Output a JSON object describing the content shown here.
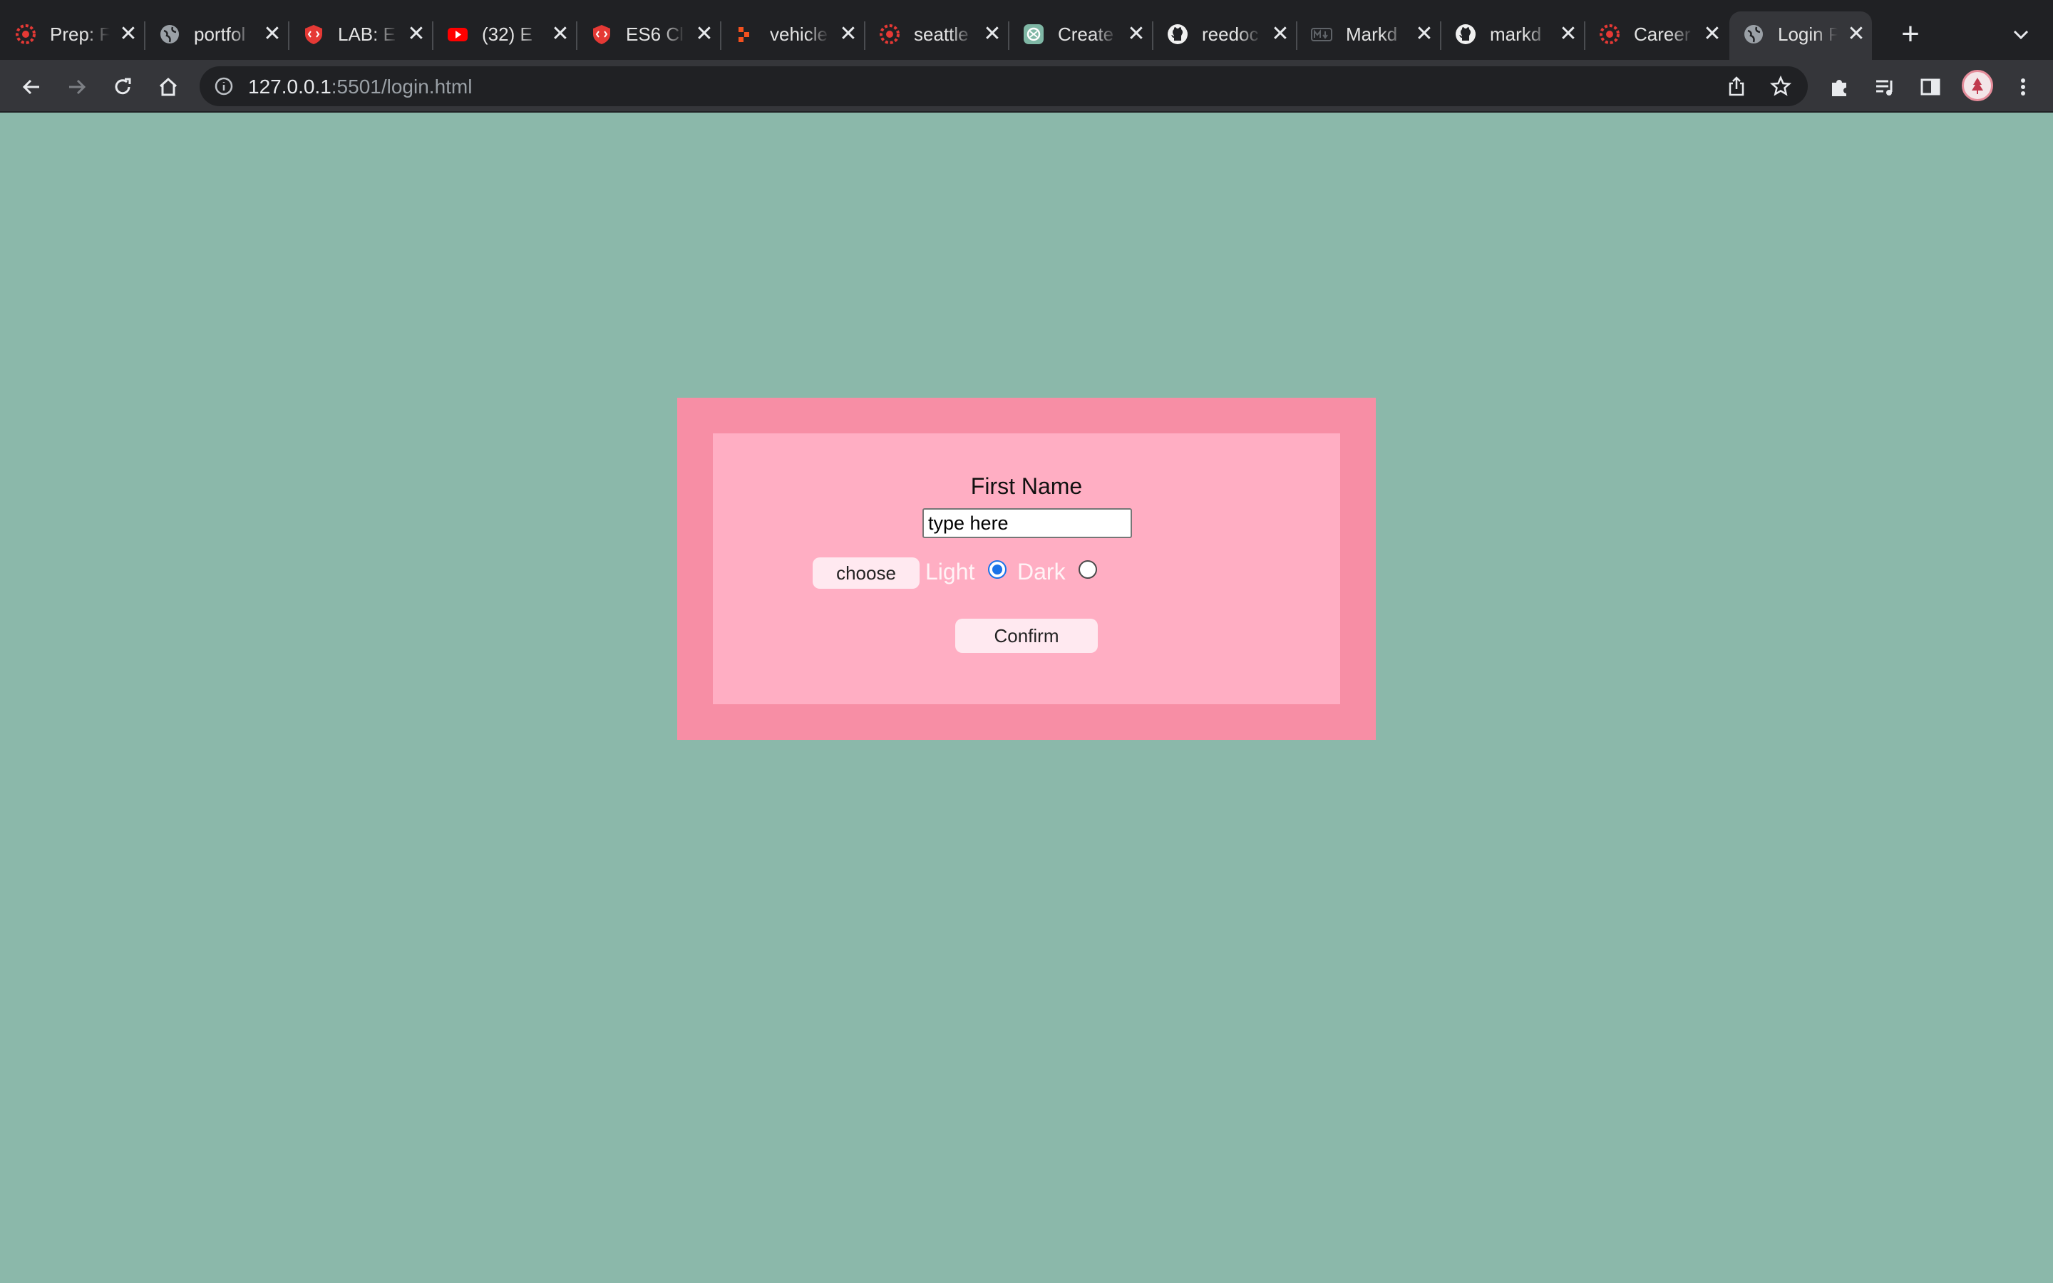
{
  "browser": {
    "tabs": [
      {
        "title": "Prep: F",
        "icon": "red-gear-icon"
      },
      {
        "title": "portfol",
        "icon": "globe-icon"
      },
      {
        "title": "LAB: E",
        "icon": "code-shield-icon"
      },
      {
        "title": "(32) E",
        "icon": "youtube-icon"
      },
      {
        "title": "ES6 Cl",
        "icon": "code-shield-icon"
      },
      {
        "title": "vehicle",
        "icon": "orange-blocks-icon"
      },
      {
        "title": "seattle",
        "icon": "red-gear-icon"
      },
      {
        "title": "Create",
        "icon": "chatgpt-icon"
      },
      {
        "title": "reedoc",
        "icon": "github-icon"
      },
      {
        "title": "Markd",
        "icon": "markdown-icon"
      },
      {
        "title": "markd",
        "icon": "github-icon"
      },
      {
        "title": "Career",
        "icon": "red-gear-icon"
      },
      {
        "title": "Login P",
        "icon": "globe-icon",
        "active": true
      }
    ],
    "address": {
      "host": "127.0.0.1",
      "path": ":5501/login.html"
    }
  },
  "form": {
    "first_name_label": "First Name",
    "first_name_value": "type here",
    "choose_label": "choose",
    "light_label": "Light",
    "dark_label": "Dark",
    "selected_theme": "Light",
    "confirm_label": "Confirm"
  },
  "colors": {
    "page_background": "#8bb8aa",
    "outer_panel": "#f78ea5",
    "inner_panel": "#ffaec3",
    "button_background": "#ffe9f0",
    "radio_accent": "#1a73e8"
  }
}
